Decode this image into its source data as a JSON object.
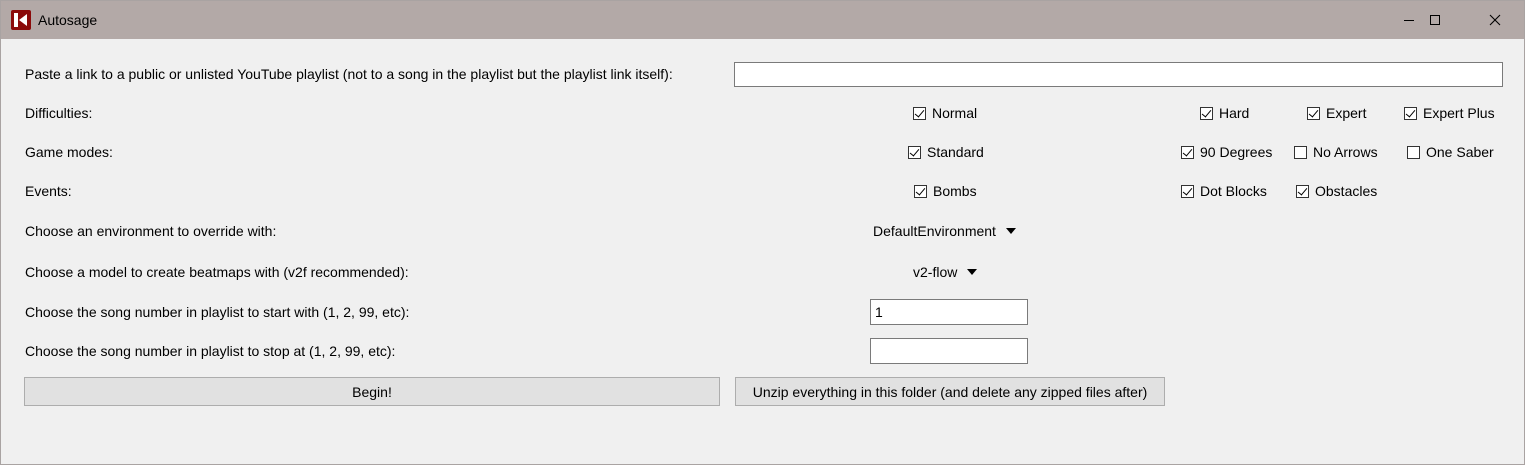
{
  "window": {
    "title": "Autosage",
    "controls": {
      "minimize": "minimize-icon",
      "maximize": "maximize-icon",
      "close": "close-icon"
    }
  },
  "playlist": {
    "label": "Paste a link to a public or unlisted YouTube playlist (not to a song in the playlist but the playlist link itself):",
    "value": ""
  },
  "difficulties": {
    "label": "Difficulties:",
    "options": [
      {
        "label": "Normal",
        "checked": true
      },
      {
        "label": "Hard",
        "checked": true
      },
      {
        "label": "Expert",
        "checked": true
      },
      {
        "label": "Expert Plus",
        "checked": true
      }
    ]
  },
  "game_modes": {
    "label": "Game modes:",
    "options": [
      {
        "label": "Standard",
        "checked": true
      },
      {
        "label": "90 Degrees",
        "checked": true
      },
      {
        "label": "No Arrows",
        "checked": false
      },
      {
        "label": "One Saber",
        "checked": false
      }
    ]
  },
  "events": {
    "label": "Events:",
    "options": [
      {
        "label": "Bombs",
        "checked": true
      },
      {
        "label": "Dot Blocks",
        "checked": true
      },
      {
        "label": "Obstacles",
        "checked": true
      }
    ]
  },
  "environment": {
    "label": "Choose an environment to override with:",
    "selected": "DefaultEnvironment"
  },
  "model": {
    "label": "Choose a model to create beatmaps with (v2f recommended):",
    "selected": "v2-flow"
  },
  "start_song": {
    "label": "Choose the song number in playlist to start with (1, 2, 99, etc):",
    "value": "1"
  },
  "stop_song": {
    "label": "Choose the song number in playlist to stop at (1, 2, 99, etc):",
    "value": ""
  },
  "buttons": {
    "begin": "Begin!",
    "unzip": "Unzip everything in this folder (and delete any zipped files after)"
  }
}
